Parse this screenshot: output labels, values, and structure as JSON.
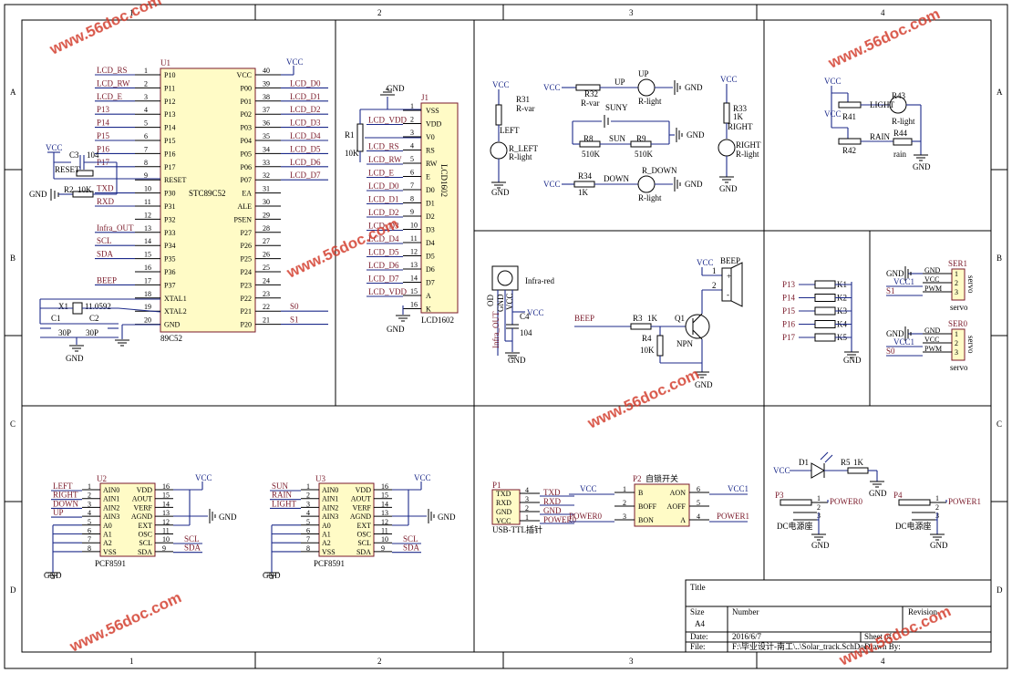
{
  "frame": {
    "col_labels": [
      "1",
      "2",
      "3",
      "4"
    ],
    "row_labels": [
      "A",
      "B",
      "C",
      "D"
    ]
  },
  "mcu": {
    "ref": "U1",
    "part": "STC89C52",
    "package": "89C52",
    "pins": [
      {
        "num": "1",
        "name": "P10",
        "net": "LCD_RS"
      },
      {
        "num": "2",
        "name": "P11",
        "net": "LCD_RW"
      },
      {
        "num": "3",
        "name": "P12",
        "net": "LCD_E"
      },
      {
        "num": "4",
        "name": "P13",
        "net": "P13"
      },
      {
        "num": "5",
        "name": "P14",
        "net": "P14"
      },
      {
        "num": "6",
        "name": "P15",
        "net": "P15"
      },
      {
        "num": "7",
        "name": "P16",
        "net": "P16"
      },
      {
        "num": "8",
        "name": "P17",
        "net": "P17"
      },
      {
        "num": "9",
        "name": "RESET",
        "net": ""
      },
      {
        "num": "10",
        "name": "P30",
        "net": "TXD"
      },
      {
        "num": "11",
        "name": "P31",
        "net": "RXD"
      },
      {
        "num": "12",
        "name": "P32",
        "net": ""
      },
      {
        "num": "13",
        "name": "P33",
        "net": "Infra_OUT"
      },
      {
        "num": "14",
        "name": "P34",
        "net": "SCL"
      },
      {
        "num": "15",
        "name": "P35",
        "net": "SDA"
      },
      {
        "num": "16",
        "name": "P36",
        "net": ""
      },
      {
        "num": "17",
        "name": "P37",
        "net": "BEEP"
      },
      {
        "num": "18",
        "name": "XTAL1",
        "net": ""
      },
      {
        "num": "19",
        "name": "XTAL2",
        "net": ""
      },
      {
        "num": "20",
        "name": "GND",
        "net": ""
      },
      {
        "num": "40",
        "name": "VCC",
        "net": "VCC"
      },
      {
        "num": "39",
        "name": "P00",
        "net": "LCD_D0"
      },
      {
        "num": "38",
        "name": "P01",
        "net": "LCD_D1"
      },
      {
        "num": "37",
        "name": "P02",
        "net": "LCD_D2"
      },
      {
        "num": "36",
        "name": "P03",
        "net": "LCD_D3"
      },
      {
        "num": "35",
        "name": "P04",
        "net": "LCD_D4"
      },
      {
        "num": "34",
        "name": "P05",
        "net": "LCD_D5"
      },
      {
        "num": "33",
        "name": "P06",
        "net": "LCD_D6"
      },
      {
        "num": "32",
        "name": "P07",
        "net": "LCD_D7"
      },
      {
        "num": "31",
        "name": "EA",
        "net": ""
      },
      {
        "num": "30",
        "name": "ALE",
        "net": ""
      },
      {
        "num": "29",
        "name": "PSEN",
        "net": ""
      },
      {
        "num": "28",
        "name": "P27",
        "net": ""
      },
      {
        "num": "27",
        "name": "P26",
        "net": ""
      },
      {
        "num": "26",
        "name": "P25",
        "net": ""
      },
      {
        "num": "25",
        "name": "P24",
        "net": ""
      },
      {
        "num": "24",
        "name": "P23",
        "net": ""
      },
      {
        "num": "23",
        "name": "P22",
        "net": ""
      },
      {
        "num": "22",
        "name": "P21",
        "net": "S0"
      },
      {
        "num": "21",
        "name": "P20",
        "net": "S1"
      }
    ],
    "reset": {
      "cap": "C3",
      "cap_val": "104",
      "button": "RESET",
      "res": "R2",
      "res_val": "10K",
      "vcc": "VCC",
      "gnd": "GND"
    },
    "crystal": {
      "ref": "X1",
      "val": "11.0592",
      "c1": "C1",
      "c1_val": "30P",
      "c2": "C2",
      "c2_val": "30P",
      "gnd": "GND"
    }
  },
  "lcd": {
    "ref": "J1",
    "part": "LCD1602",
    "body_text": "LCD1602",
    "pot": {
      "ref": "R1",
      "val": "10K"
    },
    "pins": [
      {
        "num": "1",
        "name": "VSS",
        "net": ""
      },
      {
        "num": "2",
        "name": "VDD",
        "net": "LCD_VDD"
      },
      {
        "num": "3",
        "name": "V0",
        "net": ""
      },
      {
        "num": "4",
        "name": "RS",
        "net": "LCD_RS"
      },
      {
        "num": "5",
        "name": "RW",
        "net": "LCD_RW"
      },
      {
        "num": "6",
        "name": "E",
        "net": "LCD_E"
      },
      {
        "num": "7",
        "name": "D0",
        "net": "LCD_D0"
      },
      {
        "num": "8",
        "name": "D1",
        "net": "LCD_D1"
      },
      {
        "num": "9",
        "name": "D2",
        "net": "LCD_D2"
      },
      {
        "num": "10",
        "name": "D3",
        "net": "LCD_D3"
      },
      {
        "num": "11",
        "name": "D4",
        "net": "LCD_D4"
      },
      {
        "num": "12",
        "name": "D5",
        "net": "LCD_D5"
      },
      {
        "num": "13",
        "name": "D6",
        "net": "LCD_D6"
      },
      {
        "num": "14",
        "name": "D7",
        "net": "LCD_D7"
      },
      {
        "num": "15",
        "name": "A",
        "net": "LCD_VDD"
      },
      {
        "num": "16",
        "name": "K",
        "net": ""
      }
    ],
    "gnd": "GND"
  },
  "sensors": {
    "r31": {
      "ref": "R31",
      "val": "R-var",
      "vcc": "VCC",
      "gnd": "GND"
    },
    "left": {
      "ref": "R_LEFT",
      "type": "R-light",
      "net": "LEFT"
    },
    "r32": {
      "ref": "R32",
      "val": "R-var"
    },
    "up": {
      "ref": "UP",
      "type": "R-light",
      "net": "UP"
    },
    "suny": {
      "label": "SUNY",
      "r8": "R8",
      "r8_val": "510K",
      "r9": "R9",
      "r9_val": "510K",
      "net": "SUN"
    },
    "r34": {
      "ref": "R34",
      "val": "1K"
    },
    "down": {
      "ref": "R_DOWN",
      "type": "R-light",
      "net": "DOWN"
    },
    "r33": {
      "ref": "R33",
      "val": "1K"
    },
    "right": {
      "ref": "RIGHT",
      "type": "R-light",
      "net": "RIGHT"
    },
    "vcc": "VCC",
    "gnd": "GND"
  },
  "weather": {
    "r43": {
      "ref": "R43",
      "type": "R-light",
      "net": "LIGHT"
    },
    "r44": {
      "ref": "R44",
      "type": "rain",
      "net": "RAIN"
    },
    "r41": "R41",
    "r42": "R42",
    "vcc": "VCC",
    "gnd": "GND"
  },
  "infrared": {
    "label": "Infra-red",
    "pins": [
      "OD",
      "GND",
      "VCC"
    ],
    "net": "Infra_OUT",
    "cap": "C4",
    "cap_val": "104",
    "vcc": "VCC",
    "gnd": "GND"
  },
  "buzzer": {
    "label": "BEEP",
    "net": "BEEP",
    "r3": "R3",
    "r3_val": "1K",
    "r4": "R4",
    "r4_val": "10K",
    "q": "Q1",
    "q_type": "NPN",
    "pins": [
      "1",
      "2"
    ],
    "signs": [
      "+",
      "-"
    ],
    "vcc": "VCC",
    "gnd": "GND"
  },
  "keys": {
    "items": [
      {
        "net": "P13",
        "ref": "K1"
      },
      {
        "net": "P14",
        "ref": "K2"
      },
      {
        "net": "P15",
        "ref": "K3"
      },
      {
        "net": "P16",
        "ref": "K4"
      },
      {
        "net": "P17",
        "ref": "K5"
      }
    ],
    "gnd": "GND"
  },
  "servos": [
    {
      "ref": "SER1",
      "part": "servo",
      "pins": [
        "GND",
        "VCC",
        "PWM"
      ],
      "nets": [
        "GND",
        "VCC1",
        "S1"
      ]
    },
    {
      "ref": "SER0",
      "part": "servo",
      "pins": [
        "GND",
        "VCC",
        "PWM"
      ],
      "nets": [
        "GND",
        "VCC1",
        "S0"
      ]
    }
  ],
  "adcs": [
    {
      "ref": "U2",
      "part": "PCF8591",
      "nets": [
        "LEFT",
        "RIGHT",
        "DOWN",
        "UP"
      ],
      "out_nets": [
        "SCL",
        "SDA"
      ]
    },
    {
      "ref": "U3",
      "part": "PCF8591",
      "nets": [
        "SUN",
        "RAIN",
        "LIGHT",
        ""
      ],
      "out_nets": [
        "SCL",
        "SDA"
      ]
    }
  ],
  "adc_pins_left": [
    {
      "num": "1",
      "name": "AIN0"
    },
    {
      "num": "2",
      "name": "AIN1"
    },
    {
      "num": "3",
      "name": "AIN2"
    },
    {
      "num": "4",
      "name": "AIN3"
    },
    {
      "num": "5",
      "name": "A0"
    },
    {
      "num": "6",
      "name": "A1"
    },
    {
      "num": "7",
      "name": "A2"
    },
    {
      "num": "8",
      "name": "VSS"
    }
  ],
  "adc_pins_right": [
    {
      "num": "16",
      "name": "VDD"
    },
    {
      "num": "15",
      "name": "AOUT"
    },
    {
      "num": "14",
      "name": "VERF"
    },
    {
      "num": "13",
      "name": "AGND"
    },
    {
      "num": "12",
      "name": "EXT"
    },
    {
      "num": "11",
      "name": "OSC"
    },
    {
      "num": "10",
      "name": "SCL"
    },
    {
      "num": "9",
      "name": "SDA"
    }
  ],
  "usb": {
    "ref": "P1",
    "label": "USB-TTL插针",
    "pins": [
      {
        "num": "4",
        "name": "TXD",
        "net": "TXD"
      },
      {
        "num": "3",
        "name": "RXD",
        "net": "RXD"
      },
      {
        "num": "2",
        "name": "GND",
        "net": "GND"
      },
      {
        "num": "1",
        "name": "VCC",
        "net": "POWER0"
      }
    ]
  },
  "switch": {
    "ref": "P2",
    "label": "自锁开关",
    "left": [
      {
        "num": "1",
        "name": "B",
        "net": "VCC"
      },
      {
        "num": "2",
        "name": "BOFF",
        "net": ""
      },
      {
        "num": "3",
        "name": "BON",
        "net": "POWER0"
      }
    ],
    "right": [
      {
        "num": "6",
        "name": "AON",
        "net": "VCC1"
      },
      {
        "num": "5",
        "name": "AOFF",
        "net": ""
      },
      {
        "num": "4",
        "name": "A",
        "net": "POWER1"
      }
    ]
  },
  "led": {
    "ref": "D1",
    "res": "R5",
    "res_val": "1K",
    "vcc": "VCC",
    "gnd": "GND"
  },
  "dc_jacks": [
    {
      "ref": "P3",
      "label": "DC电源座",
      "net": "POWER0",
      "pins": [
        "1",
        "2",
        "3"
      ],
      "gnd": "GND"
    },
    {
      "ref": "P4",
      "label": "DC电源座",
      "net": "POWER1",
      "pins": [
        "1",
        "2",
        "3"
      ],
      "gnd": "GND"
    }
  ],
  "title_block": {
    "title_label": "Title",
    "size_label": "Size",
    "size_val": "A4",
    "number_label": "Number",
    "revision_label": "Revision",
    "date_label": "Date:",
    "date_val": "2016/6/7",
    "file_label": "File:",
    "file_val": "F:\\毕业设计-南工\\..\\Solar_track.SchDoc",
    "sheet_label": "Sheet of",
    "drawn_label": "Drawn By:"
  },
  "watermark": "www.56doc.com"
}
